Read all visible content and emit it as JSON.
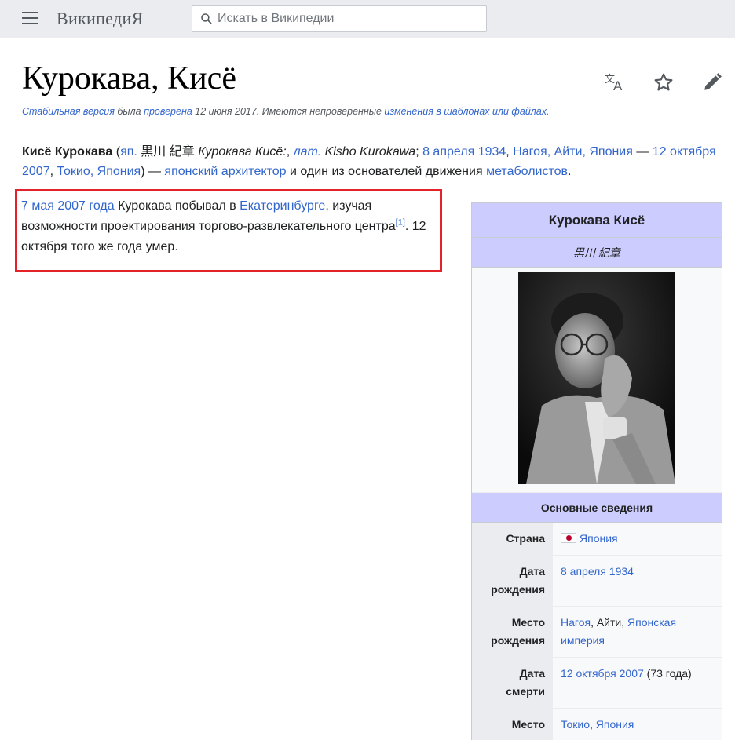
{
  "header": {
    "logo_text": "ВикипедиЯ",
    "search_placeholder": "Искать в Википедии"
  },
  "page": {
    "title": "Курокава, Кисё"
  },
  "stable_note": {
    "part1": "Стабильная версия",
    "part2": " была ",
    "part3": "проверена",
    "part4": " 12 июня 2017. Имеются непроверенные ",
    "part5": "изменения в шаблонах или файлах",
    "part6": "."
  },
  "lead": {
    "name_bold": "Кисё Курокава",
    "t1": " (",
    "l_jap": "яп.",
    "t2": " 黒川 紀章 ",
    "t3_italic": "Курокава Кисё:",
    "t4": ", ",
    "l_lat": "лат.",
    "t5": " ",
    "t6_italic": "Kisho Kurokawa",
    "t7": "; ",
    "l_birthdate": "8 апреля 1934",
    "t8": ", ",
    "l_nagoya": "Нагоя, Айти, Япония",
    "t9": " — ",
    "l_deathdate": "12 октября 2007",
    "t10": ", ",
    "l_tokyo": "Токио, Япония",
    "t11": ") — ",
    "l_architect": "японский архитектор",
    "t12": " и один из основателей движения ",
    "l_metabolists": "метаболистов",
    "t13": "."
  },
  "para2": {
    "l_date": "7 мая 2007 года",
    "t1": " Курокава побывал в ",
    "l_city": "Екатеринбурге",
    "t2": ", изучая возможности проектирования торгово-развлекательного центра",
    "ref": "[1]",
    "t3": ". 12 октября того же года умер."
  },
  "infobox": {
    "title": "Курокава Кисё",
    "native_name": "黒川 紀章",
    "section": "Основные сведения",
    "rows": [
      {
        "label": "Страна",
        "value_link": "Япония"
      },
      {
        "label": "Дата рождения",
        "value_link": "8 апреля 1934"
      },
      {
        "label": "Место рождения",
        "value_link1": "Нагоя",
        "value_text": ", Айти, ",
        "value_link2": "Японская империя"
      },
      {
        "label": "Дата смерти",
        "value_link": "12 октября 2007",
        "value_text": " (73 года)"
      },
      {
        "label": "Место смерти",
        "value_link1": "Токио",
        "value_text": ", ",
        "value_link2": "Япония"
      }
    ]
  },
  "colors": {
    "link": "#3366cc",
    "infobox_header": "#ccccff",
    "highlight_border": "#e3222a",
    "header_bg": "#eaecf0"
  },
  "icons": [
    "menu-icon",
    "search-icon",
    "language-icon",
    "star-icon",
    "edit-pencil-icon",
    "japan-flag-icon"
  ]
}
